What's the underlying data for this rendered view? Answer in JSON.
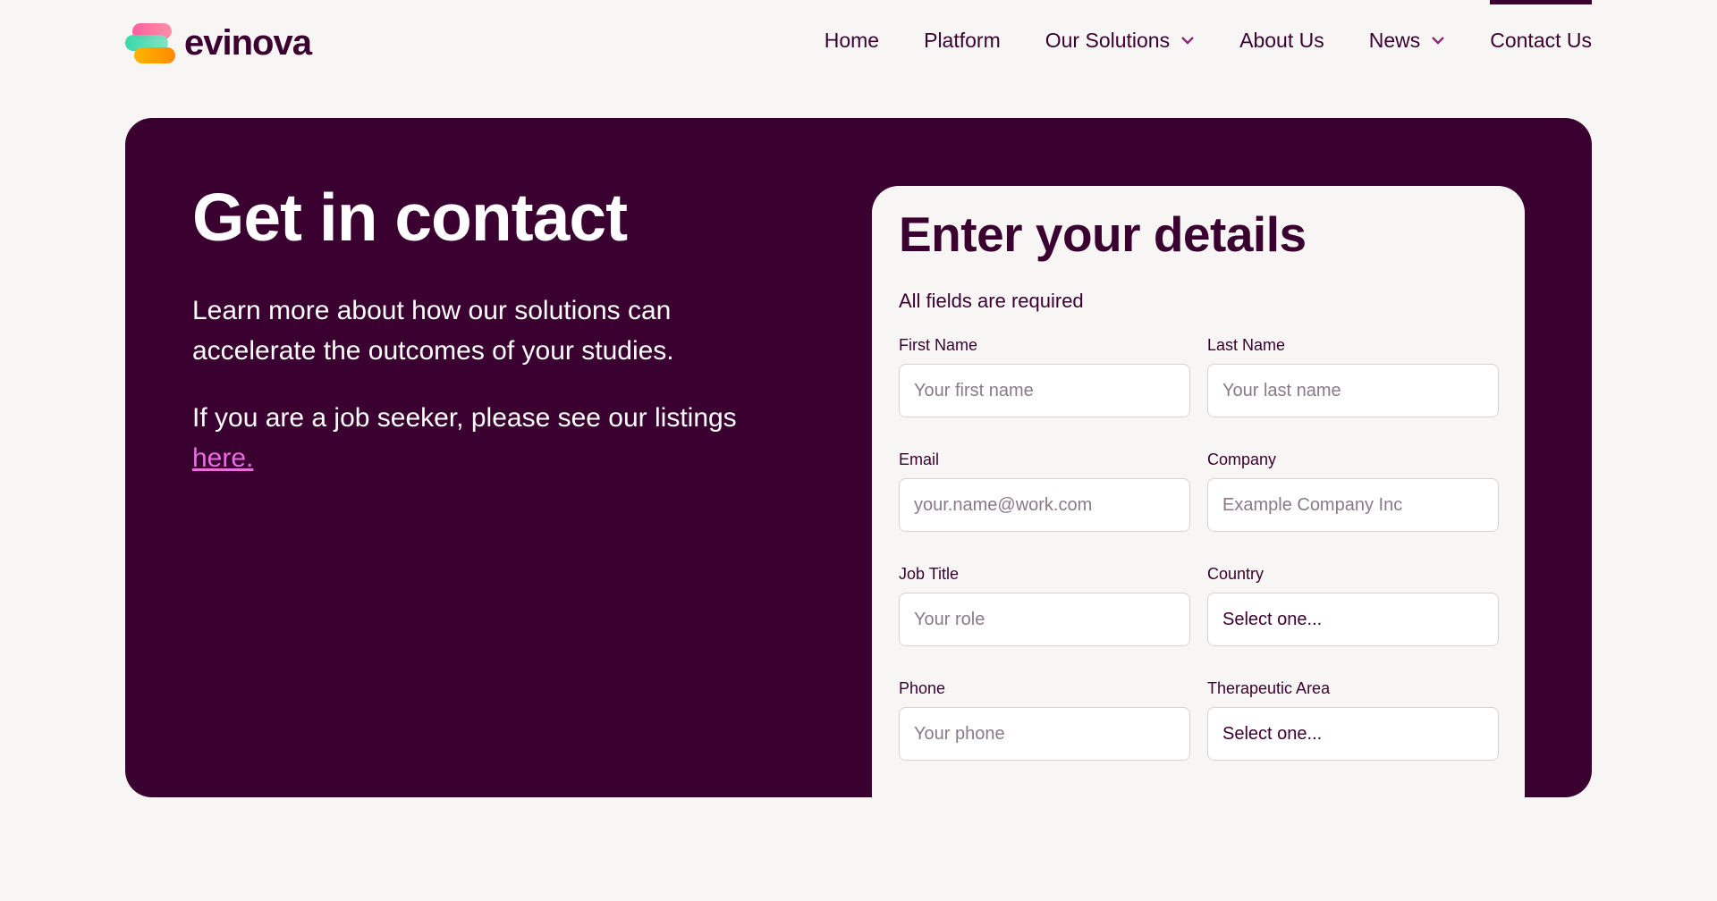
{
  "header": {
    "logo_text": "evinova",
    "nav": [
      {
        "label": "Home",
        "dropdown": false,
        "active": false
      },
      {
        "label": "Platform",
        "dropdown": false,
        "active": false
      },
      {
        "label": "Our Solutions",
        "dropdown": true,
        "active": false
      },
      {
        "label": "About Us",
        "dropdown": false,
        "active": false
      },
      {
        "label": "News",
        "dropdown": true,
        "active": false
      },
      {
        "label": "Contact Us",
        "dropdown": false,
        "active": true
      }
    ]
  },
  "hero": {
    "title": "Get in contact",
    "intro": "Learn more about how our solutions can accelerate the outcomes of your studies.",
    "job_text": "If you are a job seeker, please see our listings ",
    "job_link": "here."
  },
  "form": {
    "title": "Enter your details",
    "note": "All fields are required",
    "first_name": {
      "label": "First Name",
      "placeholder": "Your first name"
    },
    "last_name": {
      "label": "Last Name",
      "placeholder": "Your last name"
    },
    "email": {
      "label": "Email",
      "placeholder": "your.name@work.com"
    },
    "company": {
      "label": "Company",
      "placeholder": "Example Company Inc"
    },
    "job_title": {
      "label": "Job Title",
      "placeholder": "Your role"
    },
    "country": {
      "label": "Country",
      "value": "Select one..."
    },
    "phone": {
      "label": "Phone",
      "placeholder": "Your phone"
    },
    "therapeutic_area": {
      "label": "Therapeutic Area",
      "value": "Select one..."
    }
  },
  "colors": {
    "brand_dark": "#3a0030",
    "link_accent": "#e86be0",
    "page_bg": "#f8f6f4"
  }
}
